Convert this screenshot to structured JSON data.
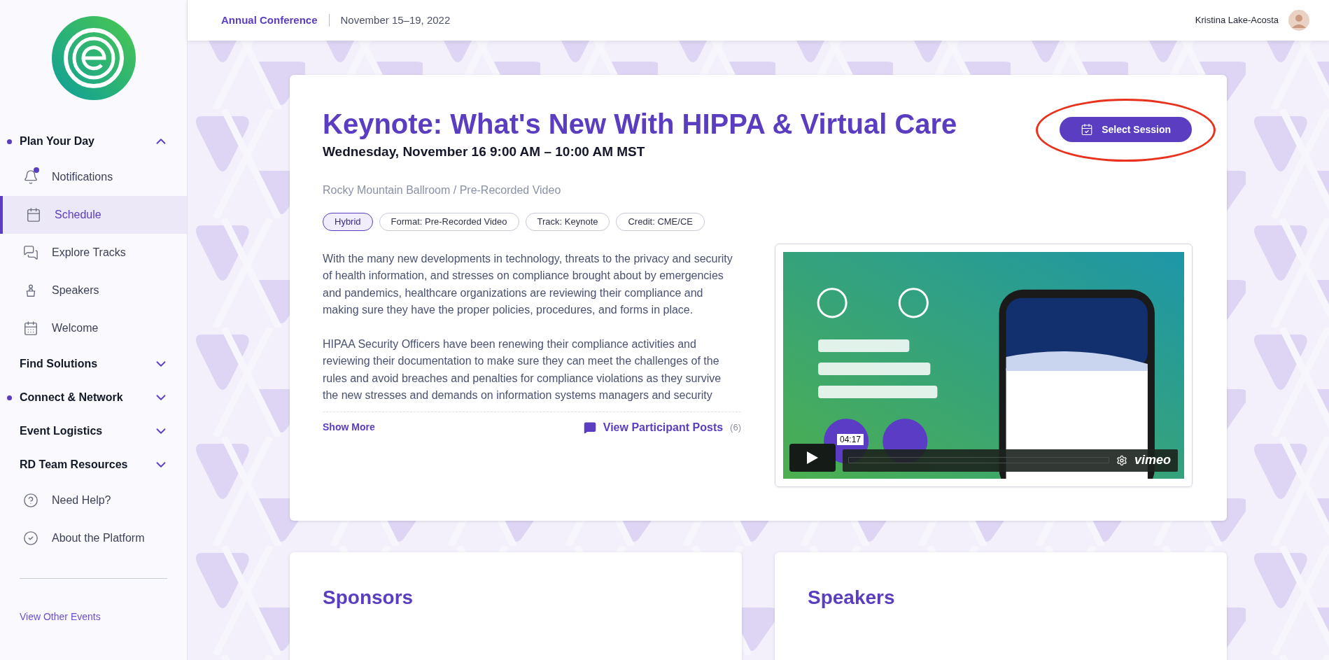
{
  "header": {
    "event": "Annual Conference",
    "dates": "November 15–19, 2022",
    "user": "Kristina Lake-Acosta"
  },
  "sidebar": {
    "nav": [
      {
        "kind": "section",
        "label": "Plan Your Day",
        "dot": true,
        "expanded": true,
        "children": [
          {
            "kind": "item",
            "label": "Notifications",
            "selected": false,
            "dot": true
          },
          {
            "kind": "item",
            "label": "Schedule",
            "selected": true,
            "dot": false
          },
          {
            "kind": "item",
            "label": "Explore Tracks",
            "selected": false,
            "dot": false
          },
          {
            "kind": "item",
            "label": "Speakers",
            "selected": false,
            "dot": false
          },
          {
            "kind": "item",
            "label": "Welcome",
            "selected": false,
            "dot": false
          }
        ]
      },
      {
        "kind": "section",
        "label": "Find Solutions",
        "dot": false,
        "expanded": false
      },
      {
        "kind": "section",
        "label": "Connect & Network",
        "dot": true,
        "expanded": false
      },
      {
        "kind": "section",
        "label": "Event Logistics",
        "dot": false,
        "expanded": false
      },
      {
        "kind": "section",
        "label": "RD Team Resources",
        "dot": false,
        "expanded": false
      },
      {
        "kind": "item",
        "label": "Need Help?",
        "selected": false,
        "dot": false
      },
      {
        "kind": "item",
        "label": "About the Platform",
        "selected": false,
        "dot": false
      }
    ],
    "footer_link": "View Other Events"
  },
  "session": {
    "title": "Keynote: What's New With HIPPA & Virtual Care",
    "datetime": "Wednesday, November 16 9:00 AM – 10:00 AM MST",
    "location": "Rocky Mountain Ballroom / Pre-Recorded Video",
    "select_button": {
      "label": "Select Session",
      "annotated": true
    },
    "tags": [
      {
        "label": "Hybrid",
        "selected": true
      },
      {
        "label": "Format: Pre-Recorded Video",
        "selected": false
      },
      {
        "label": "Track: Keynote",
        "selected": false
      },
      {
        "label": "Credit: CME/CE",
        "selected": false
      }
    ],
    "paragraphs": [
      "With the many new developments in technology, threats to the privacy and security of health information, and stresses on compliance brought about by emergencies and pandemics, healthcare organizations are reviewing their compliance and making sure they have the proper policies, procedures, and forms in place.",
      "HIPAA Security Officers have been renewing their compliance activities and reviewing their documentation to make sure they can meet the challenges of the rules and avoid breaches and penalties for compliance violations as they survive the new stresses and demands on information systems managers and security"
    ],
    "show_more": "Show More",
    "posts_link": "View Participant Posts",
    "posts_count": "(6)",
    "video": {
      "kind": "picture",
      "time_tooltip": "04:17",
      "brand": "vimeo"
    }
  },
  "panels": [
    {
      "title": "Sponsors"
    },
    {
      "title": "Speakers"
    }
  ]
}
